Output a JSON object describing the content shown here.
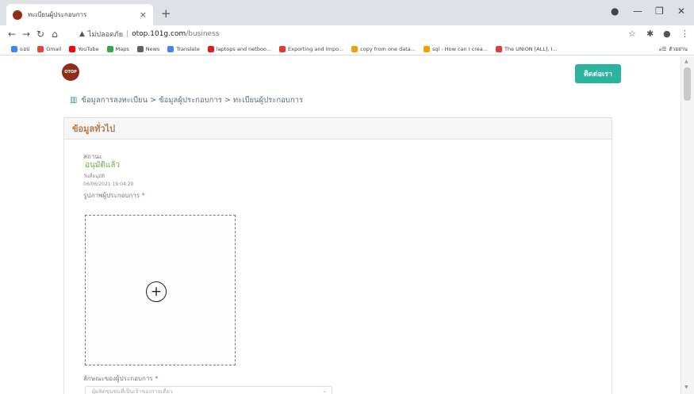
{
  "browser": {
    "tab_title": "ทะเบียนผู้ประกอบการ",
    "tab_close": "×",
    "new_tab": "+",
    "not_secure": "ไม่ปลอดภัย",
    "url_host": "otop.101g.com",
    "url_path": "/business",
    "bookmarks": [
      {
        "label": "แอป",
        "color": "#4285f4"
      },
      {
        "label": "Gmail",
        "color": "#ea4335"
      },
      {
        "label": "YouTube",
        "color": "#ff0000"
      },
      {
        "label": "Maps",
        "color": "#34a853"
      },
      {
        "label": "News",
        "color": "#5f6368"
      },
      {
        "label": "Translate",
        "color": "#4285f4"
      },
      {
        "label": "laptops and netboo...",
        "color": "#e31b23"
      },
      {
        "label": "Exporting and Impo...",
        "color": "#e53935"
      },
      {
        "label": "copy from one data...",
        "color": "#f4a100"
      },
      {
        "label": "sql - How can I crea...",
        "color": "#f4a100"
      },
      {
        "label": "The UNION [ALL], I...",
        "color": "#e53935"
      }
    ],
    "bookmarks_more": "»",
    "reading_list": "ตัวอย่าน"
  },
  "header": {
    "logo_text": "OTOP",
    "contact_button": "ติดต่อเรา"
  },
  "breadcrumb": {
    "text": "ข้อมูลการลงทะเบียน > ข้อมูลผู้ประกอบการ > ทะเบียนผู้ประกอบการ"
  },
  "card": {
    "title": "ข้อมูลทั่วไป",
    "status_label": "สถานะ",
    "status_value": "อนุมัติแล้ว",
    "date_label": "วันที่อนุมัติ",
    "date_value": "06/06/2021 19:04:20",
    "photo_label": "รูปภาพผู้ประกอบการ",
    "required_mark": "*",
    "upload_icon": "plus-circle-icon",
    "type_label": "ลักษณะของผู้ประกอบการ",
    "type_placeholder": "ผู้ผลิตชุมชนที่เป็นเจ้าของรายเดียว"
  },
  "colors": {
    "accent": "#2ab39d",
    "status_green": "#6ab04c",
    "card_title": "#b47a4a",
    "logo": "#8b2e1a"
  }
}
